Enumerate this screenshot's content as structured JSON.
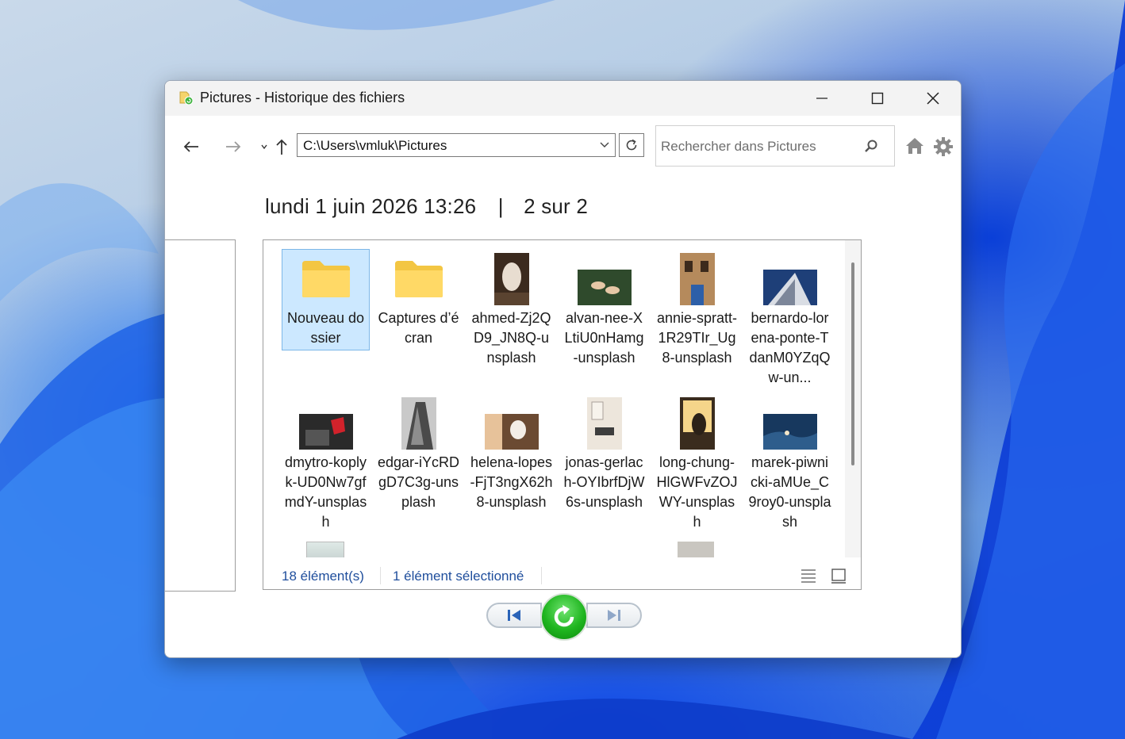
{
  "window": {
    "title": "Pictures - Historique des fichiers"
  },
  "toolbar": {
    "address": "C:\\Users\\vmluk\\Pictures",
    "search_placeholder": "Rechercher dans Pictures"
  },
  "header": {
    "date": "lundi 1 juin 2026 13:26",
    "separator": "|",
    "position": "2 sur 2"
  },
  "items": [
    {
      "name": "Nouveau dossier",
      "type": "folder",
      "selected": true
    },
    {
      "name": "Captures d’écran",
      "type": "folder",
      "selected": false
    },
    {
      "name": "ahmed-Zj2QD9_JN8Q-unsplash",
      "type": "photo"
    },
    {
      "name": "alvan-nee-XLtiU0nHamg-unsplash",
      "type": "photo"
    },
    {
      "name": "annie-spratt-1R29TIr_Ug8-unsplash",
      "type": "photo"
    },
    {
      "name": "bernardo-lorena-ponte-TdanM0YZqQw-un...",
      "type": "photo"
    },
    {
      "name": "dmytro-koplyk-UD0Nw7gfmdY-unsplash",
      "type": "photo"
    },
    {
      "name": "edgar-iYcRDgD7C3g-unsplash",
      "type": "photo"
    },
    {
      "name": "helena-lopes-FjT3ngX62h8-unsplash",
      "type": "photo"
    },
    {
      "name": "jonas-gerlach-OYIbrfDjW6s-unsplash",
      "type": "photo"
    },
    {
      "name": "long-chung-HlGWFvZOJWY-unsplash",
      "type": "photo"
    },
    {
      "name": "marek-piwnicki-aMUe_C9roy0-unsplash",
      "type": "photo"
    }
  ],
  "status": {
    "count": "18 élément(s)",
    "selected": "1 élément sélectionné"
  },
  "colors": {
    "accent": "#1f4e9c",
    "selection": "#cce8ff",
    "restore_green": "#1fb51f"
  }
}
